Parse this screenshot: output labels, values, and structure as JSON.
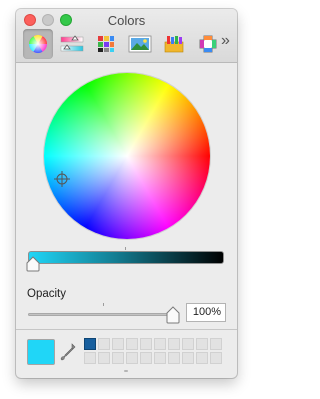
{
  "window": {
    "title": "Colors"
  },
  "toolbar": {
    "tabs": [
      {
        "icon": "color-wheel-icon"
      },
      {
        "icon": "color-sliders-icon"
      },
      {
        "icon": "color-palettes-icon"
      },
      {
        "icon": "image-palettes-icon"
      },
      {
        "icon": "pencils-icon"
      },
      {
        "icon": "custom-picker-icon"
      }
    ],
    "overflow_label": "»"
  },
  "color": {
    "current": "#20d6f7",
    "brightness_start": "#20d6f7",
    "brightness_end": "#000000"
  },
  "opacity": {
    "label": "Opacity",
    "value": "100%"
  },
  "swatches": {
    "filled_color": "#175f9e"
  }
}
